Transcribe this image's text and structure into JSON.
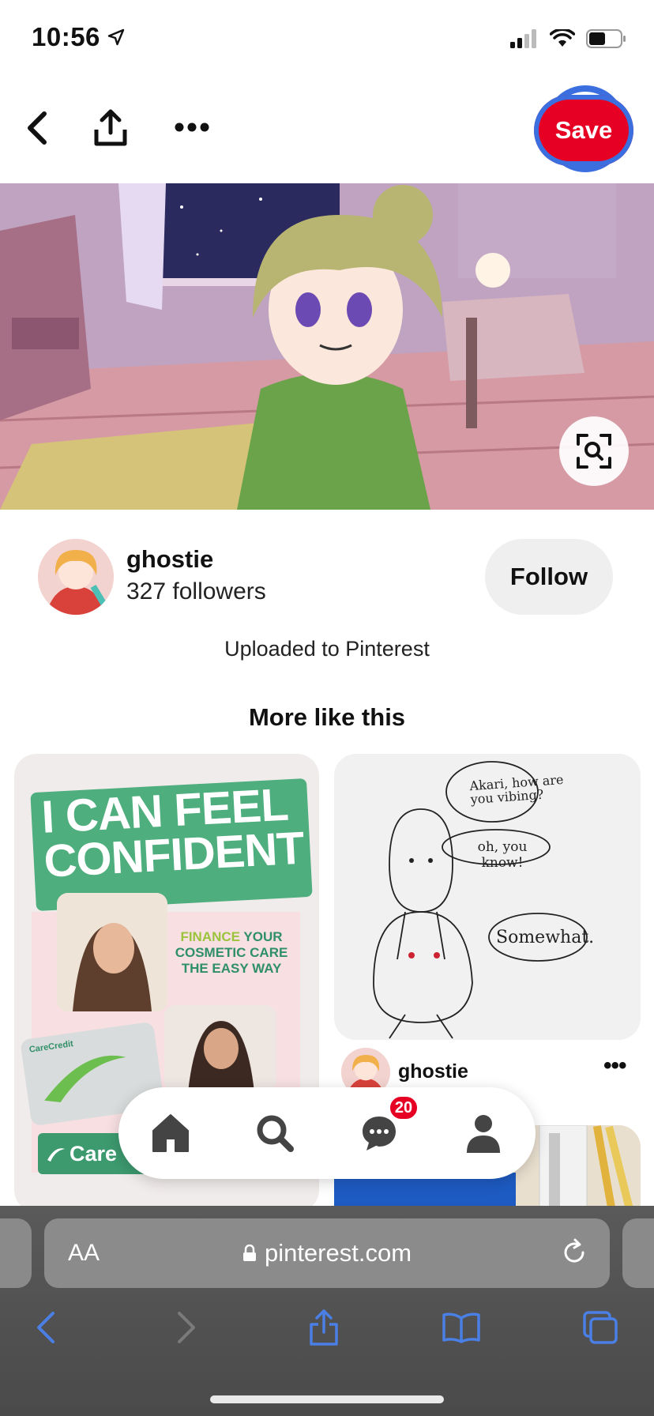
{
  "status_bar": {
    "time": "10:56"
  },
  "top_bar": {
    "save_label": "Save"
  },
  "creator": {
    "name": "ghostie",
    "followers": "327 followers",
    "follow_label": "Follow"
  },
  "uploaded_text": "Uploaded to Pinterest",
  "more_title": "More like this",
  "pins": [
    {
      "headline_1": "I CAN FEEL",
      "headline_2": "CONFIDENT",
      "tagline_1": "FINANCE",
      "tagline_1b": "YOUR",
      "tagline_2": "COSMETIC CARE",
      "tagline_3": "THE EASY WAY",
      "card_brand": "CareCredit",
      "footer_brand": "Care"
    },
    {
      "bubble_1": "Akari, how are you vibing?",
      "bubble_2": "oh, you know!",
      "bubble_3": "Somewhat.",
      "creator_name": "ghostie",
      "more_label": "•••"
    }
  ],
  "bottom_nav": {
    "messages_badge": "20"
  },
  "safari": {
    "aa_label": "AA",
    "url": "pinterest.com"
  },
  "colors": {
    "brand_red": "#e60023",
    "highlight_blue": "#3b6fe0",
    "ios_blue": "#4a7fe6"
  }
}
